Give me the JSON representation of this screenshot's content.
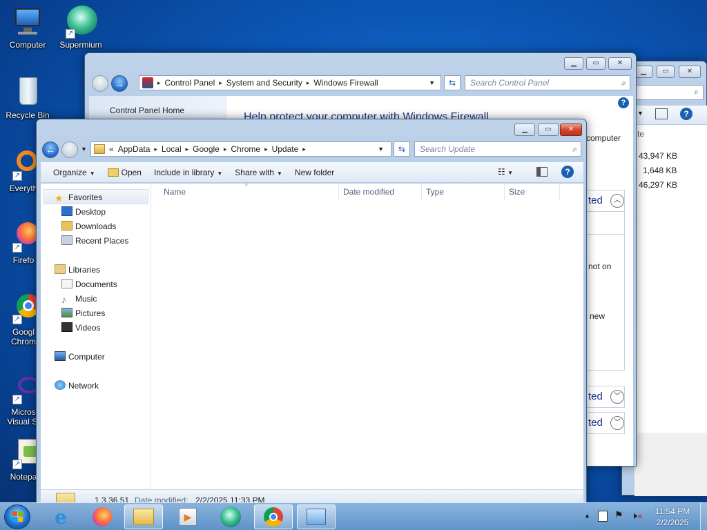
{
  "desktop": {
    "icons": [
      {
        "label": "Computer",
        "icon": "computer-icon"
      },
      {
        "label": "Supermium",
        "icon": "supermium-icon"
      },
      {
        "label": "Recycle Bin",
        "icon": "recycle-bin-icon"
      },
      {
        "label": "Everyth",
        "icon": "everything-icon"
      },
      {
        "label": "Firefo",
        "icon": "firefox-icon"
      },
      {
        "label": "Googl",
        "label2": "Chrom",
        "icon": "chrome-icon"
      },
      {
        "label": "Micros",
        "label2": "Visual St",
        "icon": "visual-studio-icon"
      },
      {
        "label": "Notepa",
        "icon": "notepad-icon"
      }
    ]
  },
  "back_window": {
    "sizes": [
      "43,947 KB",
      "1,648 KB",
      "46,297 KB"
    ],
    "col_fragment": "te"
  },
  "firewall_window": {
    "breadcrumb": [
      "Control Panel",
      "System and Security",
      "Windows Firewall"
    ],
    "search_placeholder": "Search Control Panel",
    "sidebar_home": "Control Panel Home",
    "heading": "Help protect your computer with Windows Firewall",
    "frag_computer": "computer",
    "frag_ted1": "ted",
    "frag_not_on": "not on",
    "frag_new": "new",
    "frag_ted2": "ted",
    "frag_ted3": "ted"
  },
  "explorer": {
    "breadcrumb_prefix": "«",
    "breadcrumb": [
      "AppData",
      "Local",
      "Google",
      "Chrome",
      "Update"
    ],
    "search_placeholder": "Search Update",
    "toolbar": {
      "organize": "Organize",
      "open": "Open",
      "include": "Include in library",
      "share": "Share with",
      "new_folder": "New folder"
    },
    "nav": {
      "favorites": "Favorites",
      "desktop": "Desktop",
      "downloads": "Downloads",
      "recent": "Recent Places",
      "libraries": "Libraries",
      "documents": "Documents",
      "music": "Music",
      "pictures": "Pictures",
      "videos": "Videos",
      "computer": "Computer",
      "network": "Network"
    },
    "columns": {
      "name": "Name",
      "date": "Date modified",
      "type": "Type",
      "size": "Size"
    },
    "details": {
      "name": "1.3.36.51",
      "date_label": "Date modified:",
      "date_value": "2/2/2025 11:33 PM"
    }
  },
  "taskbar": {
    "time": "11:54 PM",
    "date": "2/2/2025"
  }
}
